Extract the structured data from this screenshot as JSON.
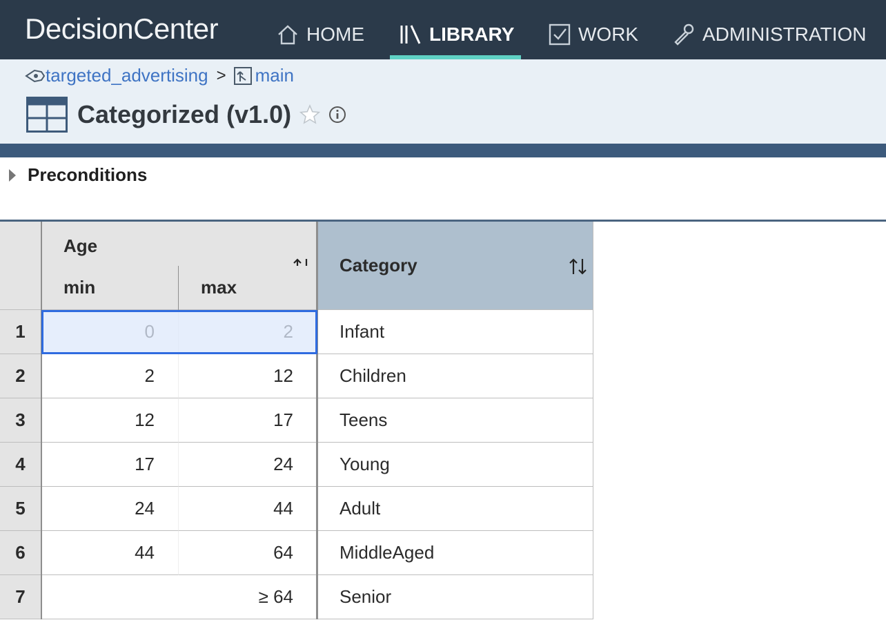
{
  "app": {
    "brand": "DecisionCenter",
    "nav": [
      {
        "label": "HOME",
        "icon": "home-icon"
      },
      {
        "label": "LIBRARY",
        "icon": "library-icon",
        "active": true
      },
      {
        "label": "WORK",
        "icon": "checkbox-icon"
      },
      {
        "label": "ADMINISTRATION",
        "icon": "wrench-icon"
      }
    ],
    "accent": "#5fd1c4"
  },
  "breadcrumb": {
    "project": "targeted_advertising",
    "separator": ">",
    "branch": "main"
  },
  "artifact": {
    "title": "Categorized (v1.0)"
  },
  "preconditions": {
    "label": "Preconditions"
  },
  "table": {
    "group_header": "Age",
    "sub_headers": [
      "min",
      "max"
    ],
    "action_header": "Category",
    "sort_icon": "sort-arrows-icon",
    "rows": [
      {
        "n": "1",
        "min": "0",
        "max": "2",
        "category": "Infant"
      },
      {
        "n": "2",
        "min": "2",
        "max": "12",
        "category": "Children"
      },
      {
        "n": "3",
        "min": "12",
        "max": "17",
        "category": "Teens"
      },
      {
        "n": "4",
        "min": "17",
        "max": "24",
        "category": "Young"
      },
      {
        "n": "5",
        "min": "24",
        "max": "44",
        "category": "Adult"
      },
      {
        "n": "6",
        "min": "44",
        "max": "64",
        "category": "MiddleAged"
      },
      {
        "n": "7",
        "merged": "≥ 64",
        "category": "Senior"
      }
    ]
  }
}
